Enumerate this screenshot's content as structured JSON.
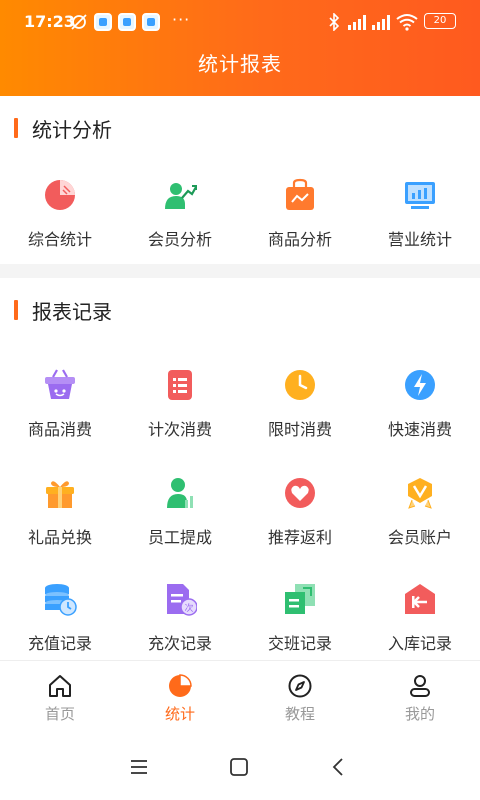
{
  "status_bar": {
    "time": "17:23",
    "battery": "20",
    "more": "···"
  },
  "header": {
    "title": "统计报表"
  },
  "analysis": {
    "title": "统计分析",
    "items": [
      {
        "label": "综合统计",
        "icon": "pie-chart-icon",
        "color": "#f25c5c"
      },
      {
        "label": "会员分析",
        "icon": "member-growth-icon",
        "color": "#2fbf71"
      },
      {
        "label": "商品分析",
        "icon": "shopping-bag-icon",
        "color": "#ff7a2e"
      },
      {
        "label": "营业统计",
        "icon": "monitor-chart-icon",
        "color": "#3aa0ff"
      }
    ]
  },
  "reports": {
    "title": "报表记录",
    "items": [
      {
        "label": "商品消费",
        "icon": "basket-icon",
        "color": "#9b6cf0"
      },
      {
        "label": "计次消费",
        "icon": "list-doc-icon",
        "color": "#f25c5c"
      },
      {
        "label": "限时消费",
        "icon": "clock-icon",
        "color": "#ffb020"
      },
      {
        "label": "快速消费",
        "icon": "lightning-icon",
        "color": "#3aa0ff"
      },
      {
        "label": "礼品兑换",
        "icon": "gift-icon",
        "color": "#ff9a2e"
      },
      {
        "label": "员工提成",
        "icon": "employee-icon",
        "color": "#2fbf71"
      },
      {
        "label": "推荐返利",
        "icon": "heart-icon",
        "color": "#f25c5c"
      },
      {
        "label": "会员账户",
        "icon": "vip-badge-icon",
        "color": "#ffb020"
      },
      {
        "label": "充值记录",
        "icon": "database-clock-icon",
        "color": "#3aa0ff"
      },
      {
        "label": "充次记录",
        "icon": "doc-times-icon",
        "color": "#9b6cf0"
      },
      {
        "label": "交班记录",
        "icon": "shift-exchange-icon",
        "color": "#2fbf71"
      },
      {
        "label": "入库记录",
        "icon": "warehouse-in-icon",
        "color": "#f25c5c"
      }
    ]
  },
  "nav": {
    "items": [
      {
        "label": "首页",
        "icon": "home-icon",
        "active": false
      },
      {
        "label": "统计",
        "icon": "stats-pie-icon",
        "active": true
      },
      {
        "label": "教程",
        "icon": "compass-icon",
        "active": false
      },
      {
        "label": "我的",
        "icon": "user-icon",
        "active": false
      }
    ],
    "active_color": "#ff6a1a",
    "inactive_color": "#999999"
  }
}
